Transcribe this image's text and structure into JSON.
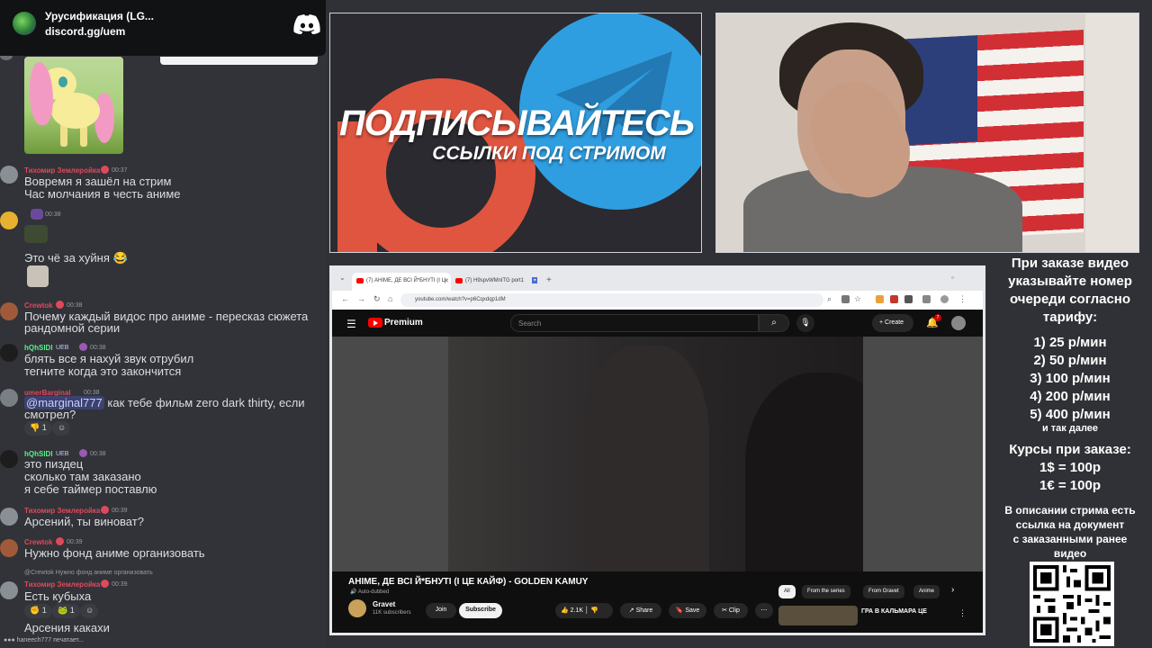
{
  "discord_invite": {
    "server_name": "Урусификация (LG...",
    "link": "discord.gg/uem"
  },
  "chat": {
    "messages": [
      {
        "user": "Тихомир Землеройка",
        "time": "00:37",
        "lines": [
          "Вовремя я зашёл на стрим",
          "Час молчания в честь аниме"
        ]
      },
      {
        "user": "",
        "time": "00:38",
        "lines": [
          "Это чё за хуйня 😂"
        ]
      },
      {
        "user": "Crewtok",
        "time": "00:38",
        "lines": [
          "Почему каждый видос про аниме - пересказ сюжета",
          "рандомной серии"
        ]
      },
      {
        "user": "hQhSlDl",
        "tag": "UEB",
        "time": "00:38",
        "lines": [
          "блять все я нахуй звук отрубил",
          "тегните когда это закончится"
        ]
      },
      {
        "user": "umerBarginal",
        "time": "00:38",
        "mention": "@marginal777",
        "lines": [
          " как тебе фильм zero dark thirty, если",
          "смотрел?"
        ],
        "reaction_count": "1"
      },
      {
        "user": "hQhSlDl",
        "tag": "UEB",
        "time": "00:38",
        "lines": [
          "это пиздец",
          "сколько там заказано",
          "я себе таймер поставлю"
        ]
      },
      {
        "user": "Тихомир Землеройка",
        "time": "00:39",
        "lines": [
          "Арсений, ты виноват?"
        ]
      },
      {
        "user": "Crewtok",
        "time": "00:39",
        "lines": [
          "Нужно фонд аниме организовать"
        ]
      },
      {
        "user": "Тихомир Землеройка",
        "time": "00:39",
        "reply": "@Crewtok Нужно фонд аниме организовать",
        "lines": [
          "Есть кубыха"
        ],
        "reactions": [
          "1",
          "1"
        ]
      },
      {
        "user": "",
        "time": "",
        "lines": [
          "Арсения какахи"
        ]
      }
    ],
    "typing": "haneech777 печатает..."
  },
  "promo": {
    "title": "ПОДПИСЫВАЙТЕСЬ",
    "subtitle": "ССЫЛКИ ПОД СТРИМОМ"
  },
  "browser": {
    "tabs": [
      {
        "label": "(7) АНІМЕ, ДЕ ВСІ Й*БНУТІ (І Ц",
        "active": true
      },
      {
        "label": "(7) H9spvWMnlTG port1",
        "active": false
      }
    ],
    "url": "youtube.com/watch?v=p6Cqxdqp1dM",
    "youtube": {
      "brand": "Premium",
      "search_placeholder": "Search",
      "create_label": "Create",
      "notif_count": "7",
      "video_title": "АНІМЕ, ДЕ ВСІ Й*БНУТІ (І ЦЕ КАЙФ) - GOLDEN KAMUY",
      "auto_dubbed": "Auto-dubbed",
      "channel": "Gravet",
      "subscribers": "11K subscribers",
      "join_label": "Join",
      "subscribe_label": "Subscribe",
      "likes": "2.1K",
      "share_label": "Share",
      "save_label": "Save",
      "clip_label": "Clip",
      "chips": [
        "All",
        "From the series",
        "From Gravet",
        "Anime"
      ],
      "rec_title": "ГРА В КАЛЬМАРА ЦЕ"
    }
  },
  "price_panel": {
    "heading": [
      "При заказе видео",
      "указывайте номер",
      "очереди согласно",
      "тарифу:"
    ],
    "tiers": [
      "1) 25 р/мин",
      "2) 50 р/мин",
      "3) 100 р/мин",
      "4) 200 р/мин",
      "5) 400 р/мин"
    ],
    "etc": "и так далее",
    "rates_heading": "Курсы при заказе:",
    "rates": [
      "1$ = 100р",
      "1€ = 100р"
    ],
    "note": [
      "В описании стрима есть",
      "ссылка на документ",
      "с заказанными ранее",
      "видео"
    ]
  },
  "colors": {
    "discord_bg": "#313338",
    "username_red": "#e0495b",
    "username_green": "#57f287",
    "youtube_red": "#ff0000",
    "telegram_blue": "#2f9ee0",
    "patreon_orange": "#e0553f"
  }
}
